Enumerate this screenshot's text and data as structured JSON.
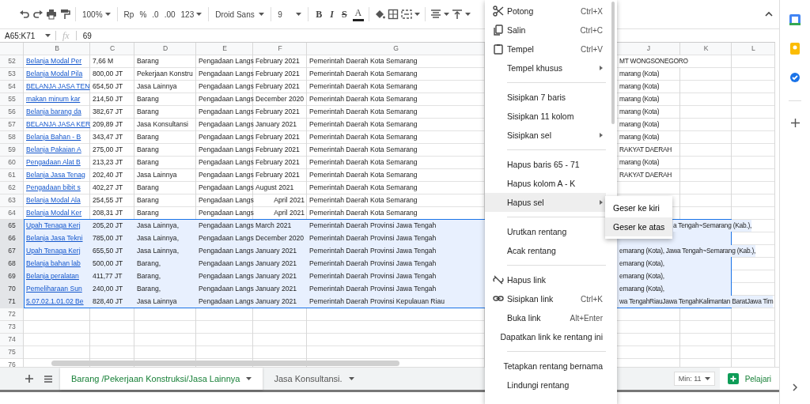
{
  "toolbar": {
    "zoom": "100%",
    "currency": "Rp",
    "percent": "%",
    "decrease_decimal": ".0",
    "increase_decimal": ".00",
    "number_format": "123",
    "font": "Droid Sans",
    "font_size": "9",
    "text_format": [
      "B",
      "I",
      "S",
      "A"
    ]
  },
  "formula_bar": {
    "cell_ref": "A65:K71",
    "fx": "fx",
    "value": "69"
  },
  "columns": [
    "B",
    "C",
    "D",
    "E",
    "F",
    "G",
    "J",
    "K",
    "L"
  ],
  "rows": [
    {
      "number": "52",
      "cells": [
        "Belanja Modal Per",
        "7,66 M",
        "Barang",
        "Pengadaan Langs",
        "February 2021",
        "Pemerintah Daerah Kota Semarang"
      ],
      "overflow": "MT WONGSONEGORO",
      "date_right": false,
      "selected": false
    },
    {
      "number": "53",
      "cells": [
        "Belanja Modal Pila",
        "800,00 JT",
        "Pekerjaan Konstru",
        "Pengadaan Langs",
        "February 2021",
        "Pemerintah Daerah Kota Semarang"
      ],
      "overflow": "marang (Kota)",
      "date_right": false,
      "selected": false
    },
    {
      "number": "54",
      "cells": [
        "BELANJA JASA TEN",
        "654,50 JT",
        "Jasa Lainnya",
        "Pengadaan Langs",
        "February 2021",
        "Pemerintah Daerah Kota Semarang"
      ],
      "overflow": "marang (Kota)",
      "date_right": false,
      "selected": false
    },
    {
      "number": "55",
      "cells": [
        "makan minum kar",
        "214,50 JT",
        "Barang",
        "Pengadaan Langs",
        "December 2020",
        "Pemerintah Daerah Kota Semarang"
      ],
      "overflow": "marang (Kota)",
      "date_right": false,
      "selected": false
    },
    {
      "number": "56",
      "cells": [
        "Belanja barang da",
        "382,67 JT",
        "Barang",
        "Pengadaan Langs",
        "February 2021",
        "Pemerintah Daerah Kota Semarang"
      ],
      "overflow": "marang (Kota)",
      "date_right": false,
      "selected": false
    },
    {
      "number": "57",
      "cells": [
        "BELANJA JASA KER",
        "209,89 JT",
        "Jasa Konsultansi",
        "Pengadaan Langs",
        "January 2021",
        "Pemerintah Daerah Kota Semarang"
      ],
      "overflow": "marang (Kota)",
      "date_right": false,
      "selected": false
    },
    {
      "number": "58",
      "cells": [
        "Belanja Bahan - B",
        "343,47 JT",
        "Barang",
        "Pengadaan Langs",
        "February 2021",
        "Pemerintah Daerah Kota Semarang"
      ],
      "overflow": "marang (Kota)",
      "date_right": false,
      "selected": false
    },
    {
      "number": "59",
      "cells": [
        "Belanja Pakaian A",
        "275,00 JT",
        "Barang",
        "Pengadaan Langs",
        "February 2021",
        "Pemerintah Daerah Kota Semarang"
      ],
      "overflow": "RAKYAT DAERAH",
      "date_right": false,
      "selected": false
    },
    {
      "number": "60",
      "cells": [
        "Pengadaan Alat B",
        "213,23 JT",
        "Barang",
        "Pengadaan Langs",
        "February 2021",
        "Pemerintah Daerah Kota Semarang"
      ],
      "overflow": "marang (Kota)",
      "date_right": false,
      "selected": false
    },
    {
      "number": "61",
      "cells": [
        "Belanja Jasa Tenag",
        "202,40 JT",
        "Jasa Lainnya",
        "Pengadaan Langs",
        "February 2021",
        "Pemerintah Daerah Kota Semarang"
      ],
      "overflow": "RAKYAT DAERAH",
      "date_right": false,
      "selected": false
    },
    {
      "number": "62",
      "cells": [
        "Pengadaan bibit s",
        "402,27 JT",
        "Barang",
        "Pengadaan Langs",
        "August 2021",
        "Pemerintah Daerah Kota Semarang"
      ],
      "date_right": false,
      "selected": false
    },
    {
      "number": "63",
      "cells": [
        "Belanja Modal Ala",
        "254,55 JT",
        "Barang",
        "Pengadaan Langs",
        "April 2021",
        "Pemerintah Daerah Kota Semarang"
      ],
      "date_right": true,
      "selected": false
    },
    {
      "number": "64",
      "cells": [
        "Belanja Modal Ker",
        "208,31 JT",
        "Barang",
        "Pengadaan Langs",
        "April 2021",
        "Pemerintah Daerah Kota Semarang"
      ],
      "date_right": true,
      "selected": false
    },
    {
      "number": "65",
      "cells": [
        "Upah Tenaga Kerj",
        "205,20 JT",
        "Jasa Lainnya,",
        "Pengadaan Langs",
        "March 2021",
        "Pemerintah Daerah Provinsi Jawa Tengah"
      ],
      "overflow": "a Tengah~Semarang (Kab.),",
      "date_right": false,
      "selected": true
    },
    {
      "number": "66",
      "cells": [
        "Belanja Jasa Tekni",
        "785,00 JT",
        "Jasa Lainnya,",
        "Pengadaan Langs",
        "December 2020",
        "Pemerintah Daerah Provinsi Jawa Tengah"
      ],
      "date_right": false,
      "selected": true
    },
    {
      "number": "67",
      "cells": [
        "Upah Tenaga Kerj",
        "655,50 JT",
        "Jasa Lainnya,",
        "Pengadaan Langs",
        "January 2021",
        "Pemerintah Daerah Provinsi Jawa Tengah"
      ],
      "overflow": "emarang (Kota), Jawa Tengah~Semarang (Kab.),",
      "date_right": false,
      "selected": true
    },
    {
      "number": "68",
      "cells": [
        "Belanja bahan lab",
        "500,00 JT",
        "Barang,",
        "Pengadaan Langs",
        "January 2021",
        "Pemerintah Daerah Provinsi Jawa Tengah"
      ],
      "overflow": "emarang (Kota),",
      "date_right": false,
      "selected": true
    },
    {
      "number": "69",
      "cells": [
        "Belanja peralatan",
        "411,77 JT",
        "Barang,",
        "Pengadaan Langs",
        "January 2021",
        "Pemerintah Daerah Provinsi Jawa Tengah"
      ],
      "overflow": "emarang (Kota),",
      "date_right": false,
      "selected": true
    },
    {
      "number": "70",
      "cells": [
        "Pemeliharaan Sun",
        "240,00 JT",
        "Barang,",
        "Pengadaan Langs",
        "January 2021",
        "Pemerintah Daerah Provinsi Jawa Tengah"
      ],
      "overflow": "emarang (Kota),",
      "date_right": false,
      "selected": true
    },
    {
      "number": "71",
      "cells": [
        "5.07.02.1.01.02 Be",
        "828,40 JT",
        "Jasa Lainnya",
        "Pengadaan Langs",
        "January 2021",
        "Pemerintah Daerah Provinsi Kepulauan Riau"
      ],
      "overflow": "wa TengahRiauJawa TengahKalimantan BaratJawa Tim",
      "date_right": false,
      "selected": true
    },
    {
      "number": "72",
      "cells": [],
      "selected": false
    },
    {
      "number": "73",
      "cells": [],
      "selected": false
    },
    {
      "number": "74",
      "cells": [],
      "selected": false
    },
    {
      "number": "75",
      "cells": [],
      "selected": false
    },
    {
      "number": "76",
      "cells": [],
      "selected": false
    }
  ],
  "context_menu": {
    "items": [
      {
        "kind": "item",
        "label": "Potong",
        "shortcut": "Ctrl+X",
        "has_submenu": false,
        "selected": false
      },
      {
        "kind": "item",
        "label": "Salin",
        "shortcut": "Ctrl+C",
        "has_submenu": false,
        "selected": false
      },
      {
        "kind": "item",
        "label": "Tempel",
        "shortcut": "Ctrl+V",
        "has_submenu": false,
        "selected": false
      },
      {
        "kind": "item",
        "label": "Tempel khusus",
        "has_submenu": true,
        "selected": false
      },
      {
        "kind": "separator"
      },
      {
        "kind": "item",
        "label": "Sisipkan 7 baris",
        "has_submenu": false,
        "selected": false
      },
      {
        "kind": "item",
        "label": "Sisipkan 11 kolom",
        "has_submenu": false,
        "selected": false
      },
      {
        "kind": "item",
        "label": "Sisipkan sel",
        "has_submenu": true,
        "selected": false
      },
      {
        "kind": "separator"
      },
      {
        "kind": "item",
        "label": "Hapus baris 65 - 71",
        "has_submenu": false,
        "selected": false
      },
      {
        "kind": "item",
        "label": "Hapus kolom A - K",
        "has_submenu": false,
        "selected": false
      },
      {
        "kind": "item",
        "label": "Hapus sel",
        "has_submenu": true,
        "selected": true
      },
      {
        "kind": "separator"
      },
      {
        "kind": "item",
        "label": "Urutkan rentang",
        "has_submenu": false,
        "selected": false
      },
      {
        "kind": "item",
        "label": "Acak rentang",
        "has_submenu": false,
        "selected": false
      },
      {
        "kind": "separator"
      },
      {
        "kind": "item",
        "label": "Hapus link",
        "has_submenu": false,
        "selected": false
      },
      {
        "kind": "item",
        "label": "Sisipkan link",
        "shortcut": "Ctrl+K",
        "has_submenu": false,
        "selected": false
      },
      {
        "kind": "item",
        "label": "Buka link",
        "shortcut": "Alt+Enter",
        "has_submenu": false,
        "selected": false
      },
      {
        "kind": "item",
        "label": "Dapatkan link ke rentang ini",
        "has_submenu": false,
        "selected": false
      },
      {
        "kind": "separator"
      },
      {
        "kind": "item",
        "label": "Tetapkan rentang bernama",
        "has_submenu": false,
        "selected": false
      },
      {
        "kind": "item",
        "label": "Lindungi rentang",
        "has_submenu": false,
        "selected": false
      }
    ]
  },
  "submenu": {
    "items": [
      {
        "label": "Geser ke kiri",
        "selected": false
      },
      {
        "label": "Geser ke atas",
        "selected": true
      }
    ]
  },
  "sheet_tabs": [
    {
      "label": "Barang /Pekerjaan Konstruksi/Jasa Lainnya",
      "selected": true
    },
    {
      "label": "Jasa Konsultansi.",
      "selected": false
    }
  ],
  "zoom_select": "Min: 11",
  "explore": "Pelajari"
}
